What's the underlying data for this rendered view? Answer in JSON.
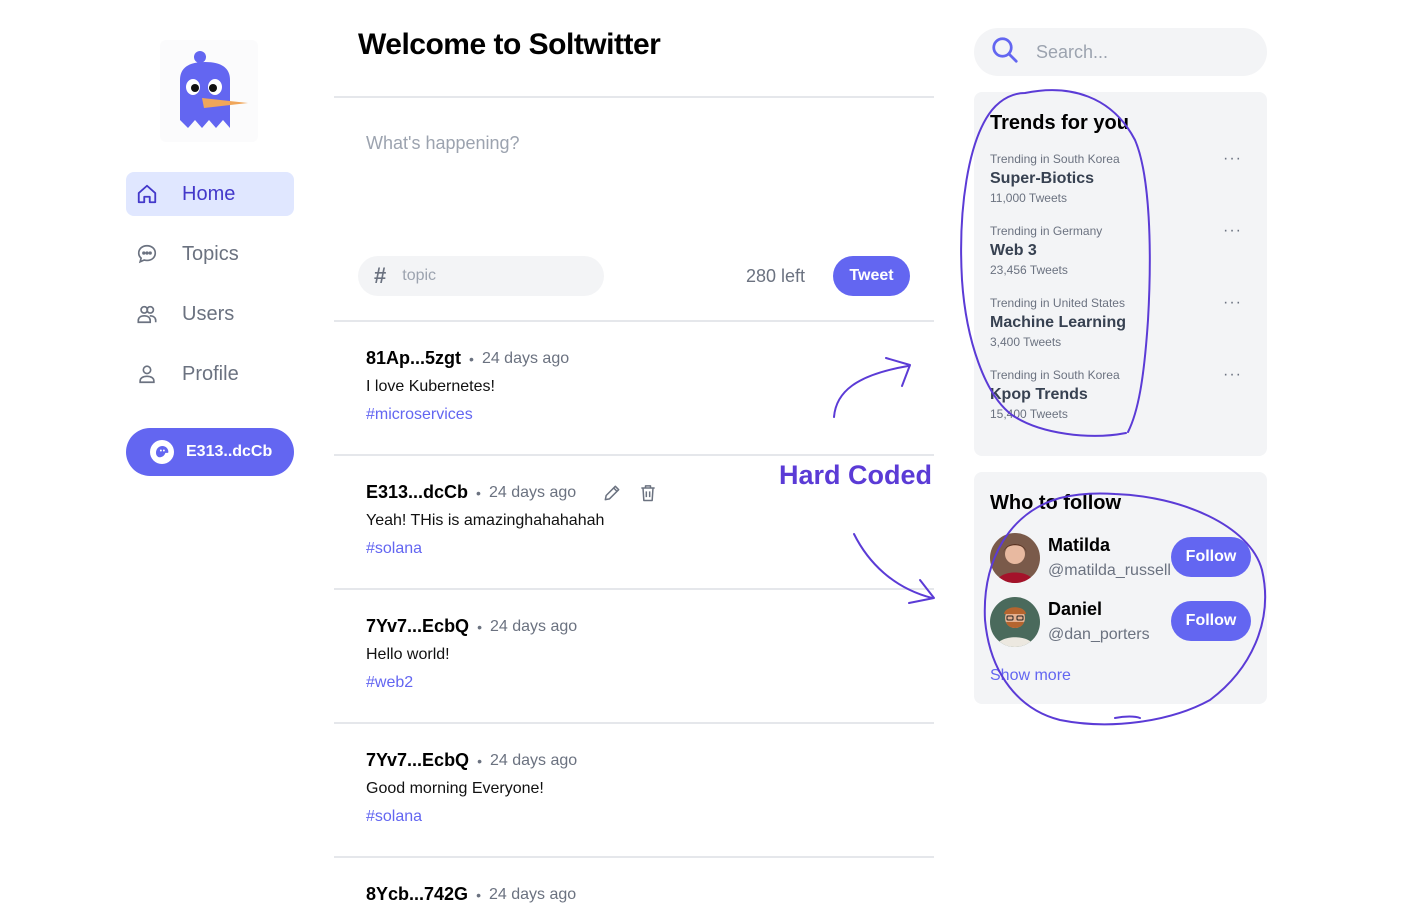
{
  "sidebar": {
    "nav": [
      {
        "label": "Home",
        "icon": "home-icon",
        "active": true
      },
      {
        "label": "Topics",
        "icon": "chat-bubble-icon",
        "active": false
      },
      {
        "label": "Users",
        "icon": "users-icon",
        "active": false
      },
      {
        "label": "Profile",
        "icon": "user-icon",
        "active": false
      }
    ],
    "wallet_label": "E313..dcCb"
  },
  "main": {
    "title": "Welcome to Soltwitter",
    "composer": {
      "placeholder": "What's happening?",
      "topic_placeholder": "topic",
      "chars_left": "280 left",
      "tweet_label": "Tweet"
    },
    "tweets": [
      {
        "author": "81Ap...5zgt",
        "time": "24 days ago",
        "content": "I love Kubernetes!",
        "tag": "#microservices",
        "own": false
      },
      {
        "author": "E313...dcCb",
        "time": "24 days ago",
        "content": "Yeah! THis is amazinghahahahah",
        "tag": "#solana",
        "own": true
      },
      {
        "author": "7Yv7...EcbQ",
        "time": "24 days ago",
        "content": "Hello world!",
        "tag": "#web2",
        "own": false
      },
      {
        "author": "7Yv7...EcbQ",
        "time": "24 days ago",
        "content": "Good morning Everyone!",
        "tag": "#solana",
        "own": false
      },
      {
        "author": "8Ycb...742G",
        "time": "24 days ago",
        "content": "",
        "tag": "",
        "own": false
      }
    ]
  },
  "right": {
    "search_placeholder": "Search...",
    "trends_title": "Trends for you",
    "trends": [
      {
        "location": "Trending in South Korea",
        "name": "Super-Biotics",
        "count": "11,000 Tweets"
      },
      {
        "location": "Trending in Germany",
        "name": "Web 3",
        "count": "23,456 Tweets"
      },
      {
        "location": "Trending in United States",
        "name": "Machine Learning",
        "count": "3,400 Tweets"
      },
      {
        "location": "Trending in South Korea",
        "name": "Kpop Trends",
        "count": "15,400 Tweets"
      }
    ],
    "more_glyph": "···",
    "follow_title": "Who to follow",
    "follow": [
      {
        "name": "Matilda",
        "handle": "@matilda_russell",
        "button": "Follow"
      },
      {
        "name": "Daniel",
        "handle": "@dan_porters",
        "button": "Follow"
      }
    ],
    "show_more": "Show more"
  },
  "annotation": {
    "text": "Hard Coded",
    "color": "#5b3bd6"
  },
  "colors": {
    "accent": "#6366f1",
    "accent_light": "#e0e7ff",
    "panel": "#f3f4f6"
  }
}
